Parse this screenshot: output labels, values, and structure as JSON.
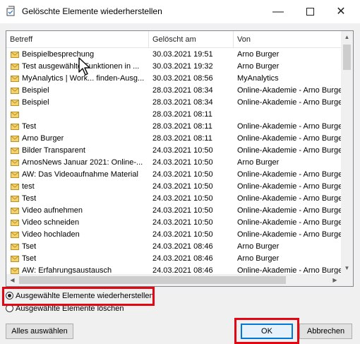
{
  "window": {
    "title": "Gelöschte Elemente wiederherstellen",
    "minimize": "—",
    "close": "✕"
  },
  "columns": {
    "subject": "Betreff",
    "deleted_at": "Gelöscht am",
    "from": "Von"
  },
  "rows": [
    {
      "subject": "Beispielbesprechung",
      "deleted_at": "30.03.2021 19:51",
      "from": "Arno Burger"
    },
    {
      "subject": "Test ausgewählte Funktionen in ...",
      "deleted_at": "30.03.2021 19:32",
      "from": "Arno Burger"
    },
    {
      "subject": "MyAnalytics | Work... finden-Ausg...",
      "deleted_at": "30.03.2021 08:56",
      "from": "MyAnalytics"
    },
    {
      "subject": "Beispiel",
      "deleted_at": "28.03.2021 08:34",
      "from": "Online-Akademie - Arno Burger"
    },
    {
      "subject": "Beispiel",
      "deleted_at": "28.03.2021 08:34",
      "from": "Online-Akademie - Arno Burger"
    },
    {
      "subject": "",
      "deleted_at": "28.03.2021 08:11",
      "from": ""
    },
    {
      "subject": "Test",
      "deleted_at": "28.03.2021 08:11",
      "from": "Online-Akademie - Arno Burger"
    },
    {
      "subject": "Arno Burger",
      "deleted_at": "28.03.2021 08:11",
      "from": "Online-Akademie - Arno Burger"
    },
    {
      "subject": "Bilder Transparent",
      "deleted_at": "24.03.2021 10:50",
      "from": "Online-Akademie - Arno Burger"
    },
    {
      "subject": "ArnosNews Januar 2021: Online-...",
      "deleted_at": "24.03.2021 10:50",
      "from": "Arno Burger"
    },
    {
      "subject": "AW: Das Videoaufnahme Material",
      "deleted_at": "24.03.2021 10:50",
      "from": "Online-Akademie - Arno Burger"
    },
    {
      "subject": "test",
      "deleted_at": "24.03.2021 10:50",
      "from": "Online-Akademie - Arno Burger"
    },
    {
      "subject": "Test",
      "deleted_at": "24.03.2021 10:50",
      "from": "Online-Akademie - Arno Burger"
    },
    {
      "subject": "Video aufnehmen",
      "deleted_at": "24.03.2021 10:50",
      "from": "Online-Akademie - Arno Burger"
    },
    {
      "subject": "Video schneiden",
      "deleted_at": "24.03.2021 10:50",
      "from": "Online-Akademie - Arno Burger"
    },
    {
      "subject": "Video hochladen",
      "deleted_at": "24.03.2021 10:50",
      "from": "Online-Akademie - Arno Burger"
    },
    {
      "subject": "Tset",
      "deleted_at": "24.03.2021 08:46",
      "from": "Arno Burger"
    },
    {
      "subject": "Tset",
      "deleted_at": "24.03.2021 08:46",
      "from": "Arno Burger"
    },
    {
      "subject": "AW: Erfahrungsaustausch",
      "deleted_at": "24.03.2021 08:46",
      "from": "Online-Akademie - Arno Burger"
    }
  ],
  "options": {
    "restore": "Ausgewählte Elemente wiederherstellen",
    "delete": "Ausgewählte Elemente löschen",
    "selected": "restore"
  },
  "buttons": {
    "select_all": "Alles auswählen",
    "ok": "OK",
    "cancel": "Abbrechen"
  },
  "icons": {
    "app": "outlook-restore-icon",
    "item": "envelope-icon"
  },
  "colors": {
    "highlight": "#e30613",
    "focus": "#0078d7"
  }
}
